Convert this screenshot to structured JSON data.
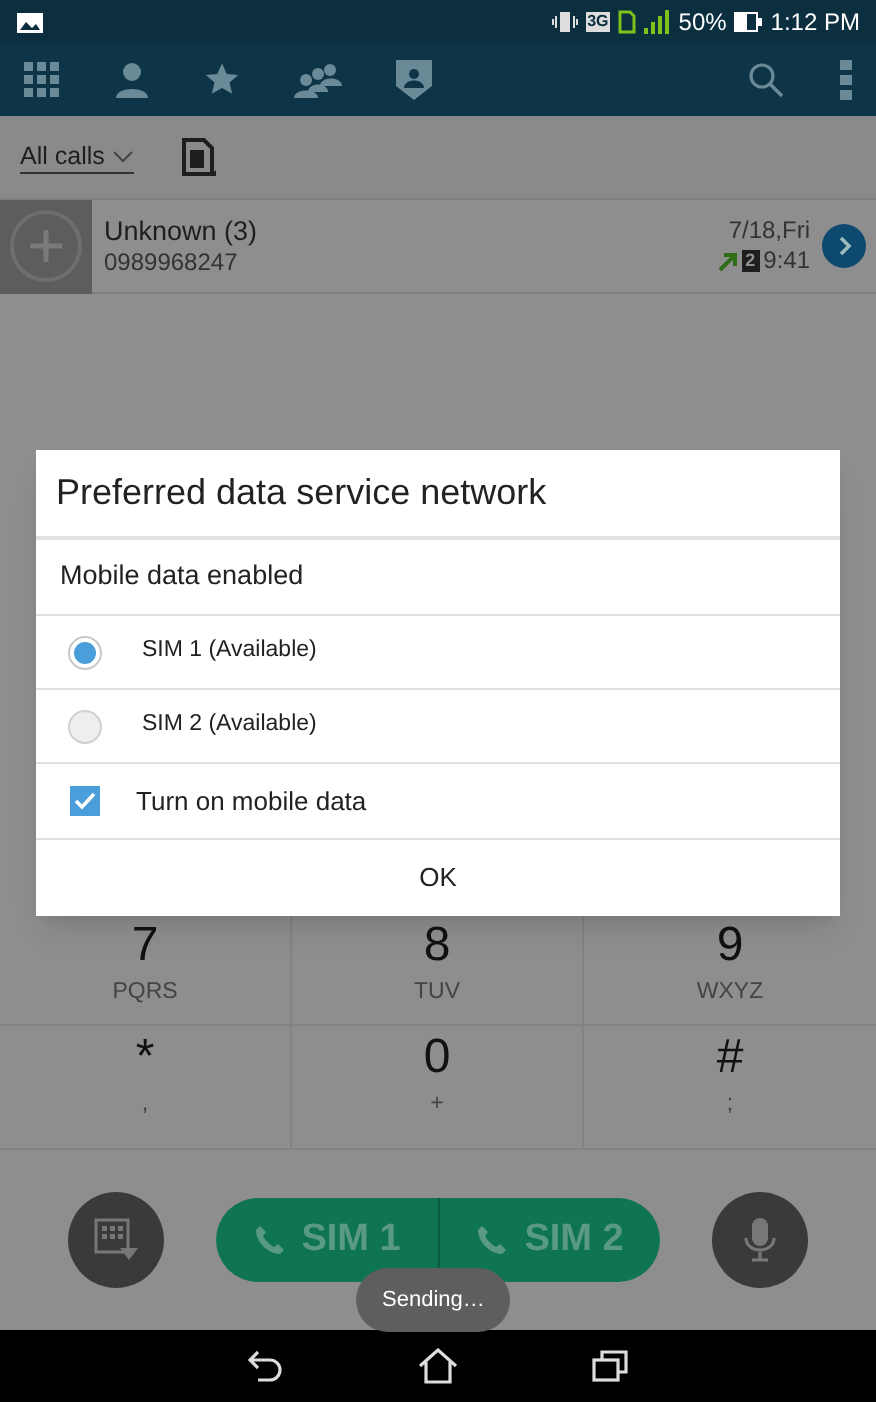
{
  "status_bar": {
    "battery": "50%",
    "time": "1:12 PM",
    "network": "3G"
  },
  "filter": {
    "label": "All calls"
  },
  "call_log": [
    {
      "name": "Unknown (3)",
      "number": "0989968247",
      "date": "7/18,Fri",
      "sim": "2",
      "time": "9:41"
    }
  ],
  "dialog": {
    "title": "Preferred data service network",
    "section": "Mobile data enabled",
    "options": [
      {
        "label": "SIM 1 (Available)",
        "selected": true
      },
      {
        "label": "SIM 2 (Available)",
        "selected": false
      }
    ],
    "checkbox": {
      "label": "Turn on mobile data",
      "checked": true
    },
    "button": "OK"
  },
  "keypad": [
    {
      "digit": "7",
      "letters": "PQRS"
    },
    {
      "digit": "8",
      "letters": "TUV"
    },
    {
      "digit": "9",
      "letters": "WXYZ"
    },
    {
      "digit": "*",
      "letters": ","
    },
    {
      "digit": "0",
      "letters": "+"
    },
    {
      "digit": "#",
      "letters": ";"
    }
  ],
  "call_buttons": [
    {
      "label": "SIM 1"
    },
    {
      "label": "SIM 2"
    }
  ],
  "toast": "Sending…"
}
